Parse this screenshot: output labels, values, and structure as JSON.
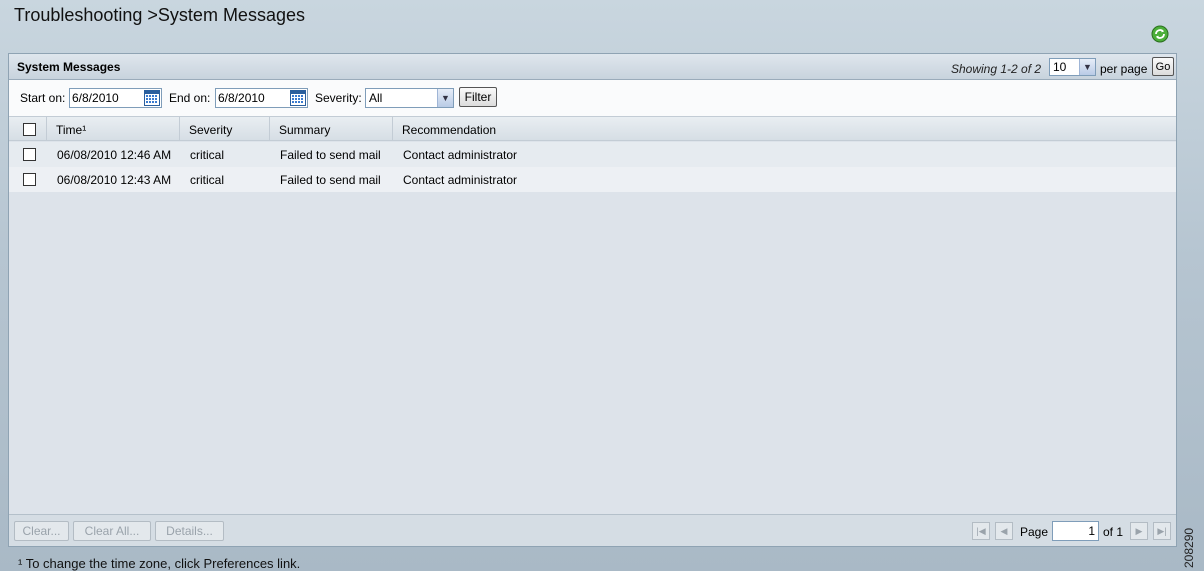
{
  "page": {
    "title": "Troubleshooting >System Messages",
    "refresh_icon": "refresh-icon"
  },
  "panel": {
    "title": "System Messages",
    "showing": "Showing 1-2 of 2",
    "per_page_value": "10",
    "per_page_label": "per page",
    "go_label": "Go"
  },
  "filter": {
    "start_label": "Start on:",
    "start_value": "6/8/2010",
    "end_label": "End on:",
    "end_value": "6/8/2010",
    "severity_label": "Severity:",
    "severity_value": "All",
    "filter_label": "Filter",
    "calendar_icon": "calendar-icon"
  },
  "table": {
    "columns": [
      "Time¹",
      "Severity",
      "Summary",
      "Recommendation"
    ],
    "rows": [
      {
        "time": "06/08/2010 12:46 AM",
        "severity": "critical",
        "summary": "Failed to send mail",
        "recommendation": "Contact administrator"
      },
      {
        "time": "06/08/2010 12:43 AM",
        "severity": "critical",
        "summary": "Failed to send mail",
        "recommendation": "Contact administrator"
      }
    ]
  },
  "footer": {
    "clear_label": "Clear...",
    "clear_all_label": "Clear All...",
    "details_label": "Details...",
    "page_label": "Page",
    "page_value": "1",
    "of_label": "of 1"
  },
  "footnote": "¹ To change the time zone, click Preferences link.",
  "figure_number": "208290",
  "colors": {
    "accent": "#7f9db9",
    "refresh_icon": "#3a9a2a"
  }
}
